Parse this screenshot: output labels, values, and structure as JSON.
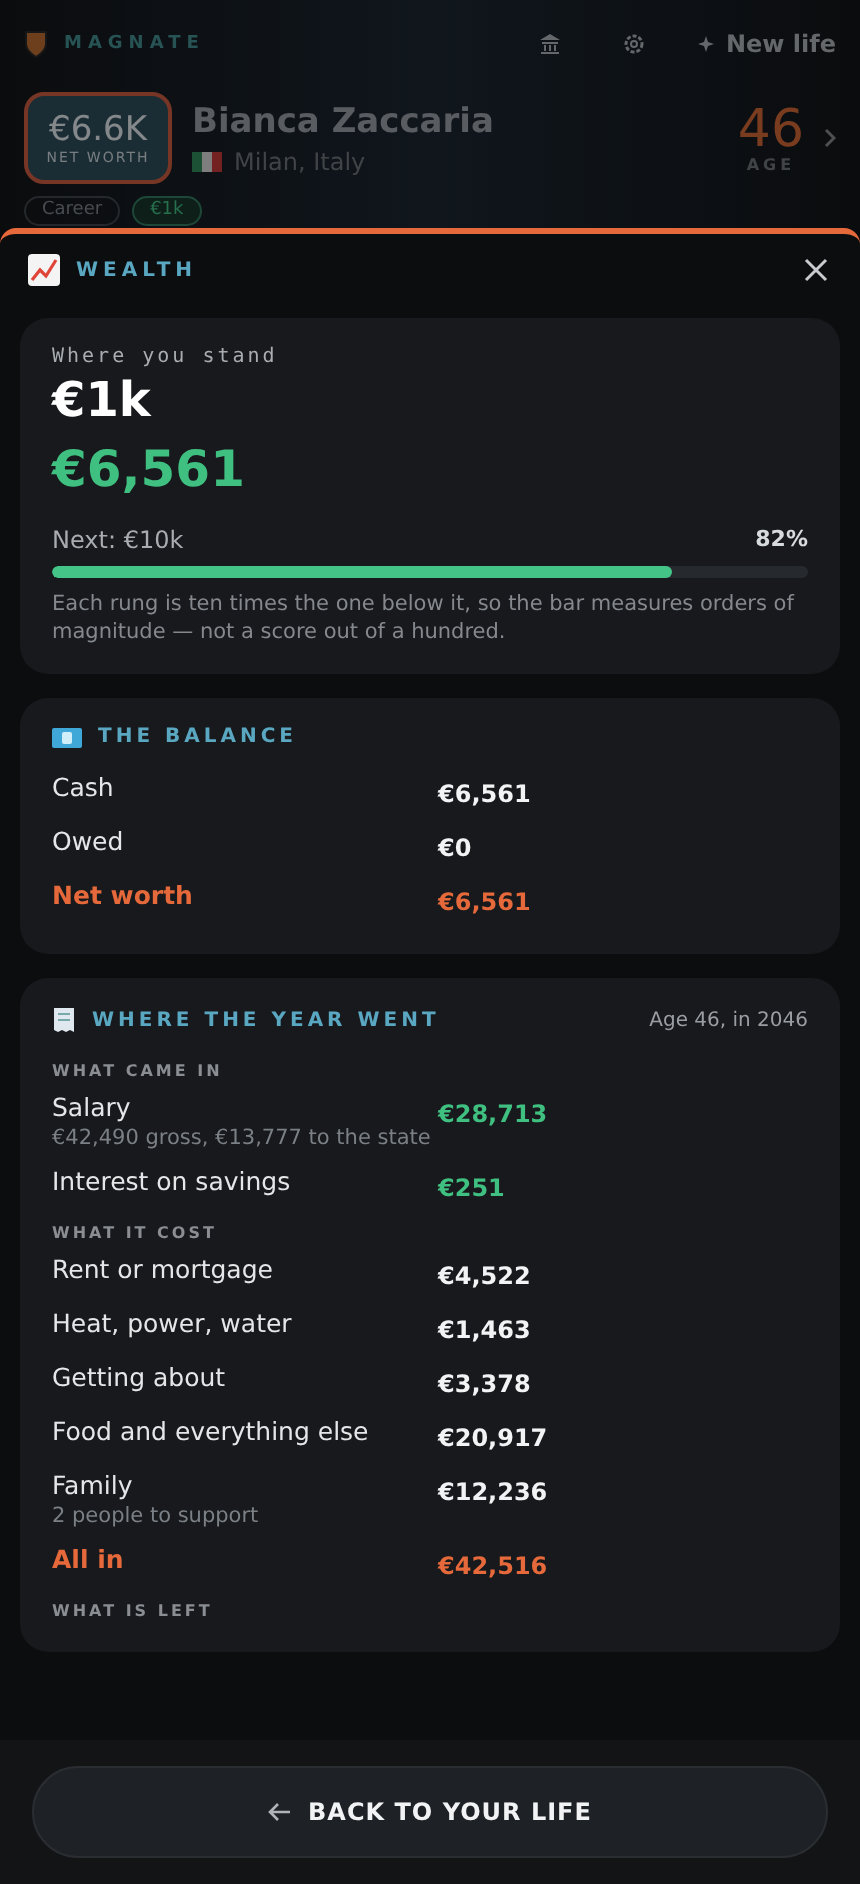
{
  "app_bar": {
    "brand": "MAGNATE",
    "new_life": "New life"
  },
  "profile": {
    "net_worth": "€6.6K",
    "net_worth_label": "NET WORTH",
    "name": "Bianca Zaccaria",
    "location": "Milan, Italy",
    "age": "46",
    "age_label": "AGE"
  },
  "chips": [
    {
      "label": "Career",
      "selected": false
    },
    {
      "label": "€1k",
      "selected": true
    }
  ],
  "sheet": {
    "title": "WEALTH",
    "standing": {
      "label": "Where you stand",
      "rung": "€1k",
      "amount": "€6,561",
      "next": "Next: €10k",
      "percent": "82%",
      "level": 0.82,
      "note": "Each rung is ten times the one below it, so the bar measures orders of magnitude — not a score out of a hundred."
    },
    "balance": {
      "title": "THE BALANCE",
      "rows": [
        {
          "label": "Cash",
          "value": "€6,561",
          "kind": "plain"
        },
        {
          "label": "Owed",
          "value": "€0",
          "kind": "plain"
        },
        {
          "label": "Net worth",
          "value": "€6,561",
          "kind": "total"
        }
      ]
    },
    "year": {
      "title": "WHERE THE YEAR WENT",
      "meta": "Age 46, in 2046",
      "groups": [
        {
          "heading": "WHAT CAME IN",
          "rows": [
            {
              "label": "Salary",
              "sub": "€42,490 gross, €13,777 to the state",
              "value": "€28,713",
              "kind": "income"
            },
            {
              "label": "Interest on savings",
              "value": "€251",
              "kind": "income"
            }
          ]
        },
        {
          "heading": "WHAT IT COST",
          "rows": [
            {
              "label": "Rent or mortgage",
              "value": "€4,522",
              "kind": "plain"
            },
            {
              "label": "Heat, power, water",
              "value": "€1,463",
              "kind": "plain"
            },
            {
              "label": "Getting about",
              "value": "€3,378",
              "kind": "plain"
            },
            {
              "label": "Food and everything else",
              "value": "€20,917",
              "kind": "plain"
            },
            {
              "label": "Family",
              "sub": "2 people to support",
              "value": "€12,236",
              "kind": "plain"
            },
            {
              "label": "All in",
              "value": "€42,516",
              "kind": "total"
            }
          ]
        },
        {
          "heading": "WHAT IS LEFT"
        }
      ]
    }
  },
  "footer": {
    "button": "BACK TO YOUR LIFE"
  }
}
